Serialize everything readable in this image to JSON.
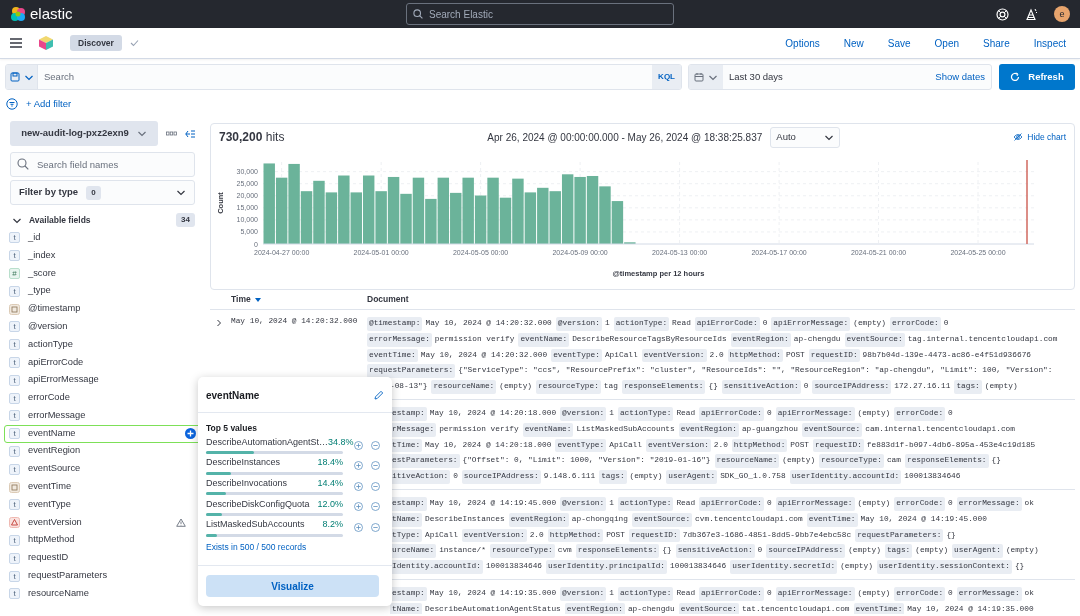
{
  "header": {
    "logo": "elastic",
    "search_placeholder": "Search Elastic",
    "avatar": "e"
  },
  "app_bar": {
    "breadcrumb": "Discover",
    "actions": [
      "Options",
      "New",
      "Save",
      "Open",
      "Share",
      "Inspect"
    ]
  },
  "query_bar": {
    "placeholder": "Search",
    "language": "KQL",
    "date_range": "Last 30 days",
    "show_dates": "Show dates",
    "refresh": "Refresh"
  },
  "add_filter": "+ Add filter",
  "sidebar": {
    "index_pattern": "new-audit-log-pxz2exn9",
    "search_placeholder": "Search field names",
    "filter_label": "Filter by type",
    "filter_count": "0",
    "section": {
      "title": "Available fields",
      "count": "34",
      "expanded": true
    },
    "fields": [
      {
        "name": "_id",
        "kind": "string",
        "token": "t",
        "selected": false
      },
      {
        "name": "_index",
        "kind": "string",
        "token": "t",
        "selected": false
      },
      {
        "name": "_score",
        "kind": "number",
        "token": "#",
        "selected": false
      },
      {
        "name": "_type",
        "kind": "string",
        "token": "t",
        "selected": false
      },
      {
        "name": "@timestamp",
        "kind": "date",
        "selected": false
      },
      {
        "name": "@version",
        "kind": "string",
        "token": "t",
        "selected": false
      },
      {
        "name": "actionType",
        "kind": "string",
        "token": "t",
        "selected": false
      },
      {
        "name": "apiErrorCode",
        "kind": "string",
        "token": "t",
        "selected": false
      },
      {
        "name": "apiErrorMessage",
        "kind": "string",
        "token": "t",
        "selected": false
      },
      {
        "name": "errorCode",
        "kind": "string",
        "token": "t",
        "selected": false
      },
      {
        "name": "errorMessage",
        "kind": "string",
        "token": "t",
        "selected": false
      },
      {
        "name": "eventName",
        "kind": "string",
        "token": "t",
        "selected": true
      },
      {
        "name": "eventRegion",
        "kind": "string",
        "token": "t",
        "selected": false
      },
      {
        "name": "eventSource",
        "kind": "string",
        "token": "t",
        "selected": false
      },
      {
        "name": "eventTime",
        "kind": "date",
        "selected": false
      },
      {
        "name": "eventType",
        "kind": "string",
        "token": "t",
        "selected": false
      },
      {
        "name": "eventVersion",
        "kind": "conflict",
        "selected": false
      },
      {
        "name": "httpMethod",
        "kind": "string",
        "token": "t",
        "selected": false
      },
      {
        "name": "requestID",
        "kind": "string",
        "token": "t",
        "selected": false
      },
      {
        "name": "requestParameters",
        "kind": "string",
        "token": "t",
        "selected": false
      },
      {
        "name": "resourceName",
        "kind": "string",
        "token": "t",
        "selected": false
      }
    ]
  },
  "chart_panel": {
    "hits": "730,200",
    "hits_label": "hits",
    "time_range": "Apr 26, 2024 @ 00:00:00.000 - May 26, 2024 @ 18:38:25.837",
    "interval": "Auto",
    "hide_chart": "Hide chart",
    "chart_data": {
      "type": "bar",
      "xlabel": "@timestamp per 12 hours",
      "ylabel": "Count",
      "categories": [
        null,
        "2024-04-27 00:00",
        null,
        null,
        null,
        null,
        null,
        null,
        null,
        "2024-05-01 00:00",
        null,
        null,
        null,
        null,
        null,
        null,
        null,
        "2024-05-05 00:00",
        null,
        null,
        null,
        null,
        null,
        null,
        null,
        "2024-05-09 00:00",
        null,
        null,
        null,
        null,
        null,
        null,
        null,
        "2024-05-13 00:00",
        null,
        null,
        null,
        null,
        null,
        null,
        null,
        "2024-05-17 00:00",
        null,
        null,
        null,
        null,
        null,
        null,
        null,
        "2024-05-21 00:00",
        null,
        null,
        null,
        null,
        null,
        null,
        null,
        "2024-05-25 00:00",
        null,
        null,
        null,
        null
      ],
      "series": [
        {
          "color": "#6bb39a",
          "values": [
            33400,
            27500,
            33200,
            21900,
            26200,
            21400,
            28400,
            21400,
            28400,
            21900,
            27800,
            20800,
            27500,
            18700,
            27500,
            21200,
            27500,
            20100,
            27500,
            19200,
            27100,
            21400,
            23300,
            21900,
            28900,
            27800,
            28200,
            23900,
            17800,
            700,
            null,
            null,
            null,
            null,
            null,
            null,
            null,
            null,
            null,
            null,
            null,
            null,
            null,
            null,
            null,
            null,
            null,
            null,
            null,
            null,
            null,
            null,
            null,
            null,
            null,
            null,
            null,
            null,
            null,
            null,
            null,
            null
          ]
        }
      ],
      "ylim": [
        0,
        34000
      ],
      "grid": true,
      "yticks": [
        {
          "value": 0,
          "label": "0"
        },
        {
          "value": 5000,
          "label": "5,000"
        },
        {
          "value": 10000,
          "label": "10,000"
        },
        {
          "value": 15000,
          "label": "15,000"
        },
        {
          "value": 20000,
          "label": "20,000"
        },
        {
          "value": 25000,
          "label": "25,000"
        },
        {
          "value": 30000,
          "label": "30,000"
        }
      ]
    }
  },
  "documents": {
    "columns": [
      {
        "label": "Time",
        "sorted": true
      },
      {
        "label": "Document",
        "sorted": false
      }
    ],
    "rows": [
      {
        "time": "May 10, 2024 @ 14:20:32.000",
        "expanded": false,
        "lines": [
          [
            {
              "key": "@timestamp:",
              "value": "May 10, 2024 @ 14:20:32.000"
            },
            {
              "key": "@version:",
              "value": "1"
            },
            {
              "key": "actionType:",
              "value": "Read"
            },
            {
              "key": "apiErrorCode:",
              "value": "0"
            },
            {
              "key": "apiErrorMessage:",
              "value": "(empty)"
            },
            {
              "key": "errorCode:",
              "value": "0"
            }
          ],
          [
            {
              "key": "errorMessage:",
              "value": "permission verify"
            },
            {
              "key": "eventName:",
              "value": "DescribeResourceTagsByResourceIds"
            },
            {
              "key": "eventRegion:",
              "value": "ap-chengdu"
            },
            {
              "key": "eventSource:",
              "value": "tag.internal.tencentcloudapi.com"
            }
          ],
          [
            {
              "key": "eventTime:",
              "value": "May 10, 2024 @ 14:20:32.000"
            },
            {
              "key": "eventType:",
              "value": "ApiCall"
            },
            {
              "key": "eventVersion:",
              "value": "2.0"
            },
            {
              "key": "httpMethod:",
              "value": "POST"
            },
            {
              "key": "requestID:",
              "value": "98b7b04d-139e-4473-ac86-e4f51d936676"
            }
          ],
          [
            {
              "key": "requestParameters:",
              "value": "{\"ServiceType\": \"ccs\", \"ResourcePrefix\": \"cluster\", \"ResourceIds\": \"\", \"ResourceRegion\": \"ap-chengdu\", \"Limit\": 100, \"Version\":"
            }
          ],
          [
            {
              "value": "-08-13\"}"
            },
            {
              "key": "resourceName:",
              "value": "(empty)"
            },
            {
              "key": "resourceType:",
              "value": "tag"
            },
            {
              "key": "responseElements:",
              "value": "{}"
            },
            {
              "key": "sensitiveAction:",
              "value": "0"
            },
            {
              "key": "sourceIPAddress:",
              "value": "172.27.16.11"
            },
            {
              "key": "tags:",
              "value": "(empty)"
            }
          ]
        ]
      },
      {
        "lines": [
          [
            {
              "key": "estamp:",
              "value": "May 10, 2024 @ 14:20:18.000"
            },
            {
              "key": "@version:",
              "value": "1"
            },
            {
              "key": "actionType:",
              "value": "Read"
            },
            {
              "key": "apiErrorCode:",
              "value": "0"
            },
            {
              "key": "apiErrorMessage:",
              "value": "(empty)"
            },
            {
              "key": "errorCode:",
              "value": "0"
            }
          ],
          [
            {
              "key": "rMessage:",
              "value": "permission verify"
            },
            {
              "key": "eventName:",
              "value": "ListMaskedSubAccounts"
            },
            {
              "key": "eventRegion:",
              "value": "ap-guangzhou"
            },
            {
              "key": "eventSource:",
              "value": "cam.internal.tencentcloudapi.com"
            }
          ],
          [
            {
              "key": "tTime:",
              "value": "May 10, 2024 @ 14:20:18.000"
            },
            {
              "key": "eventType:",
              "value": "ApiCall"
            },
            {
              "key": "eventVersion:",
              "value": "2.0"
            },
            {
              "key": "httpMethod:",
              "value": "POST"
            },
            {
              "key": "requestID:",
              "value": "fe883d1f-b097-4db6-895a-453e4c19d185"
            }
          ],
          [
            {
              "key": "estParameters:",
              "value": "{\"Offset\": 0, \"Limit\": 1000, \"Version\": \"2019-01-16\"}"
            },
            {
              "key": "resourceName:",
              "value": "(empty)"
            },
            {
              "key": "resourceType:",
              "value": "cam"
            },
            {
              "key": "responseElements:",
              "value": "{}"
            }
          ],
          [
            {
              "key": "itiveAction:",
              "value": "0"
            },
            {
              "key": "sourceIPAddress:",
              "value": "9.148.6.111"
            },
            {
              "key": "tags:",
              "value": "(empty)"
            },
            {
              "key": "userAgent:",
              "value": "SDK_GO_1.0.758"
            },
            {
              "key": "userIdentity.accountId:",
              "value": "100013834646"
            }
          ]
        ]
      },
      {
        "lines": [
          [
            {
              "key": "estamp:",
              "value": "May 10, 2024 @ 14:19:45.000"
            },
            {
              "key": "@version:",
              "value": "1"
            },
            {
              "key": "actionType:",
              "value": "Read"
            },
            {
              "key": "apiErrorCode:",
              "value": "0"
            },
            {
              "key": "apiErrorMessage:",
              "value": "(empty)"
            },
            {
              "key": "errorCode:",
              "value": "0"
            },
            {
              "key": "errorMessage:",
              "value": "ok"
            }
          ],
          [
            {
              "key": "tName:",
              "value": "DescribeInstances"
            },
            {
              "key": "eventRegion:",
              "value": "ap-chongqing"
            },
            {
              "key": "eventSource:",
              "value": "cvm.tencentcloudapi.com"
            },
            {
              "key": "eventTime:",
              "value": "May 10, 2024 @ 14:19:45.000"
            }
          ],
          [
            {
              "key": "tType:",
              "value": "ApiCall"
            },
            {
              "key": "eventVersion:",
              "value": "2.0"
            },
            {
              "key": "httpMethod:",
              "value": "POST"
            },
            {
              "key": "requestID:",
              "value": "7db367e3-1686-4851-8dd5-9bb7e4ebc58c"
            },
            {
              "key": "requestParameters:",
              "value": "{}"
            }
          ],
          [
            {
              "key": "urceName:",
              "value": "instance/*"
            },
            {
              "key": "resourceType:",
              "value": "cvm"
            },
            {
              "key": "responseElements:",
              "value": "{}"
            },
            {
              "key": "sensitiveAction:",
              "value": "0"
            },
            {
              "key": "sourceIPAddress:",
              "value": "(empty)"
            },
            {
              "key": "tags:",
              "value": "(empty)"
            },
            {
              "key": "userAgent:",
              "value": "(empty)"
            }
          ],
          [
            {
              "key": "Identity.accountId:",
              "value": "100013834646"
            },
            {
              "key": "userIdentity.principalId:",
              "value": "100013834646"
            },
            {
              "key": "userIdentity.secretId:",
              "value": "(empty)"
            },
            {
              "key": "userIdentity.sessionContext:",
              "value": "{}"
            }
          ]
        ]
      },
      {
        "lines": [
          [
            {
              "key": "estamp:",
              "value": "May 10, 2024 @ 14:19:35.000"
            },
            {
              "key": "@version:",
              "value": "1"
            },
            {
              "key": "actionType:",
              "value": "Read"
            },
            {
              "key": "apiErrorCode:",
              "value": "0"
            },
            {
              "key": "apiErrorMessage:",
              "value": "(empty)"
            },
            {
              "key": "errorCode:",
              "value": "0"
            },
            {
              "key": "errorMessage:",
              "value": "ok"
            }
          ],
          [
            {
              "key": "tName:",
              "value": "DescribeAutomationAgentStatus"
            },
            {
              "key": "eventRegion:",
              "value": "ap-chengdu"
            },
            {
              "key": "eventSource:",
              "value": "tat.tencentcloudapi.com"
            },
            {
              "key": "eventTime:",
              "value": "May 10, 2024 @ 14:19:35.000"
            }
          ]
        ]
      }
    ]
  },
  "popover": {
    "title": "eventName",
    "subtitle": "Top 5 values",
    "values": [
      {
        "name": "DescribeAutomationAgentSt…",
        "percent": "34.8%",
        "level": 0.348
      },
      {
        "name": "DescribeInstances",
        "percent": "18.4%",
        "level": 0.184
      },
      {
        "name": "DescribeInvocations",
        "percent": "14.4%",
        "level": 0.144
      },
      {
        "name": "DescribeDiskConfigQuota",
        "percent": "12.0%",
        "level": 0.12
      },
      {
        "name": "ListMaskedSubAccounts",
        "percent": "8.2%",
        "level": 0.082
      }
    ],
    "exists": "Exists in 500 / 500 records",
    "button": "Visualize"
  }
}
